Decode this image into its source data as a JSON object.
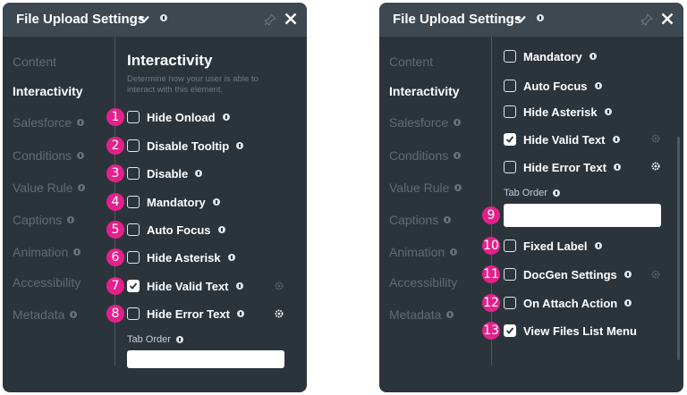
{
  "panel_left": {
    "title": "File Upload Settings",
    "nav": [
      "Content",
      "Interactivity",
      "Salesforce",
      "Conditions",
      "Value Rule",
      "Captions",
      "Animation",
      "Accessibility",
      "Metadata"
    ],
    "active_nav": "Interactivity",
    "section_title": "Interactivity",
    "section_desc": "Determine how your user is able to interact with this element.",
    "options": [
      {
        "badge": "1",
        "label": "Hide Onload",
        "checked": false
      },
      {
        "badge": "2",
        "label": "Disable Tooltip",
        "checked": false
      },
      {
        "badge": "3",
        "label": "Disable",
        "checked": false
      },
      {
        "badge": "4",
        "label": "Mandatory",
        "checked": false
      },
      {
        "badge": "5",
        "label": "Auto Focus",
        "checked": false
      },
      {
        "badge": "6",
        "label": "Hide Asterisk",
        "checked": false
      },
      {
        "badge": "7",
        "label": "Hide Valid Text",
        "checked": true
      },
      {
        "badge": "8",
        "label": "Hide Error Text",
        "checked": false
      }
    ],
    "tab_order_label": "Tab Order"
  },
  "panel_right": {
    "title": "File Upload Settings",
    "nav": [
      "Content",
      "Interactivity",
      "Salesforce",
      "Conditions",
      "Value Rule",
      "Captions",
      "Animation",
      "Accessibility",
      "Metadata"
    ],
    "active_nav": "Interactivity",
    "options_top": [
      {
        "label": "Mandatory",
        "checked": false
      },
      {
        "label": "Auto Focus",
        "checked": false
      },
      {
        "label": "Hide Asterisk",
        "checked": false
      },
      {
        "label": "Hide Valid Text",
        "checked": true
      },
      {
        "label": "Hide Error Text",
        "checked": false
      }
    ],
    "tab_order_label": "Tab Order",
    "tab_order_badge": "9",
    "tab_order_value": "",
    "options_bottom": [
      {
        "badge": "10",
        "label": "Fixed Label",
        "checked": false
      },
      {
        "badge": "11",
        "label": "DocGen Settings",
        "checked": false
      },
      {
        "badge": "12",
        "label": "On Attach Action",
        "checked": false
      },
      {
        "badge": "13",
        "label": "View Files List Menu",
        "checked": true
      }
    ]
  },
  "colors": {
    "panel_bg": "#2c343b",
    "header_bg": "#3d4850",
    "badge": "#e3218b",
    "inactive_nav": "#5f6b74"
  }
}
